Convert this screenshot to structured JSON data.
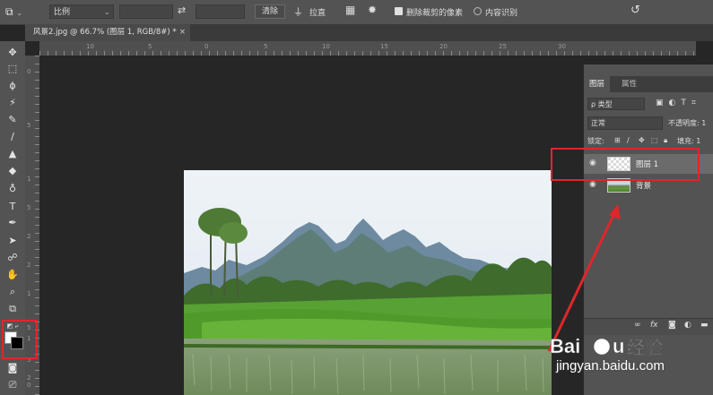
{
  "options_bar": {
    "tool_icon": "crop-icon",
    "ratio_select": "比例",
    "clear_label": "清除",
    "straighten_label": "拉直",
    "delete_cropped_label": "删除裁剪的像素",
    "content_aware_label": "内容识别",
    "delete_cropped_checked": true,
    "content_aware_checked": false
  },
  "document": {
    "tab_title": "风景2.jpg @ 66.7% (图层 1, RGB/8#) *"
  },
  "rulers": {
    "top_ticks": [
      "10",
      "5",
      "0",
      "5",
      "10",
      "15",
      "20",
      "25",
      "30"
    ],
    "left_ticks": [
      "0",
      "5",
      "1",
      "5",
      "2",
      "2",
      "1",
      "5",
      "1",
      "5",
      "2",
      "0"
    ]
  },
  "toolbar": {
    "tools": [
      "move-icon",
      "marquee-icon",
      "lasso-icon",
      "magic-wand-icon",
      "eyedropper-icon",
      "brush-icon",
      "stamp-icon",
      "eraser-icon",
      "blur-icon",
      "type-icon",
      "pen-icon",
      "path-select-icon",
      "hand-rotate-icon",
      "hand-icon",
      "zoom-icon",
      "crop-icon"
    ],
    "foreground_color": "#ffffff",
    "background_color": "#000000"
  },
  "layers_panel": {
    "tabs": [
      "图层",
      "属性"
    ],
    "filter_kind": "ρ 类型",
    "blend_mode": "正常",
    "opacity_label": "不透明度: 1",
    "lock_label": "锁定:",
    "fill_label": "填充: 1",
    "layers": [
      {
        "name": "图层 1",
        "visible": true,
        "selected": true
      },
      {
        "name": "背景",
        "visible": true,
        "selected": false
      }
    ]
  },
  "annotations": {
    "highlight_color": "#e0262a"
  },
  "watermark": {
    "brand": "Baidu经验",
    "url": "jingyan.baidu.com"
  }
}
